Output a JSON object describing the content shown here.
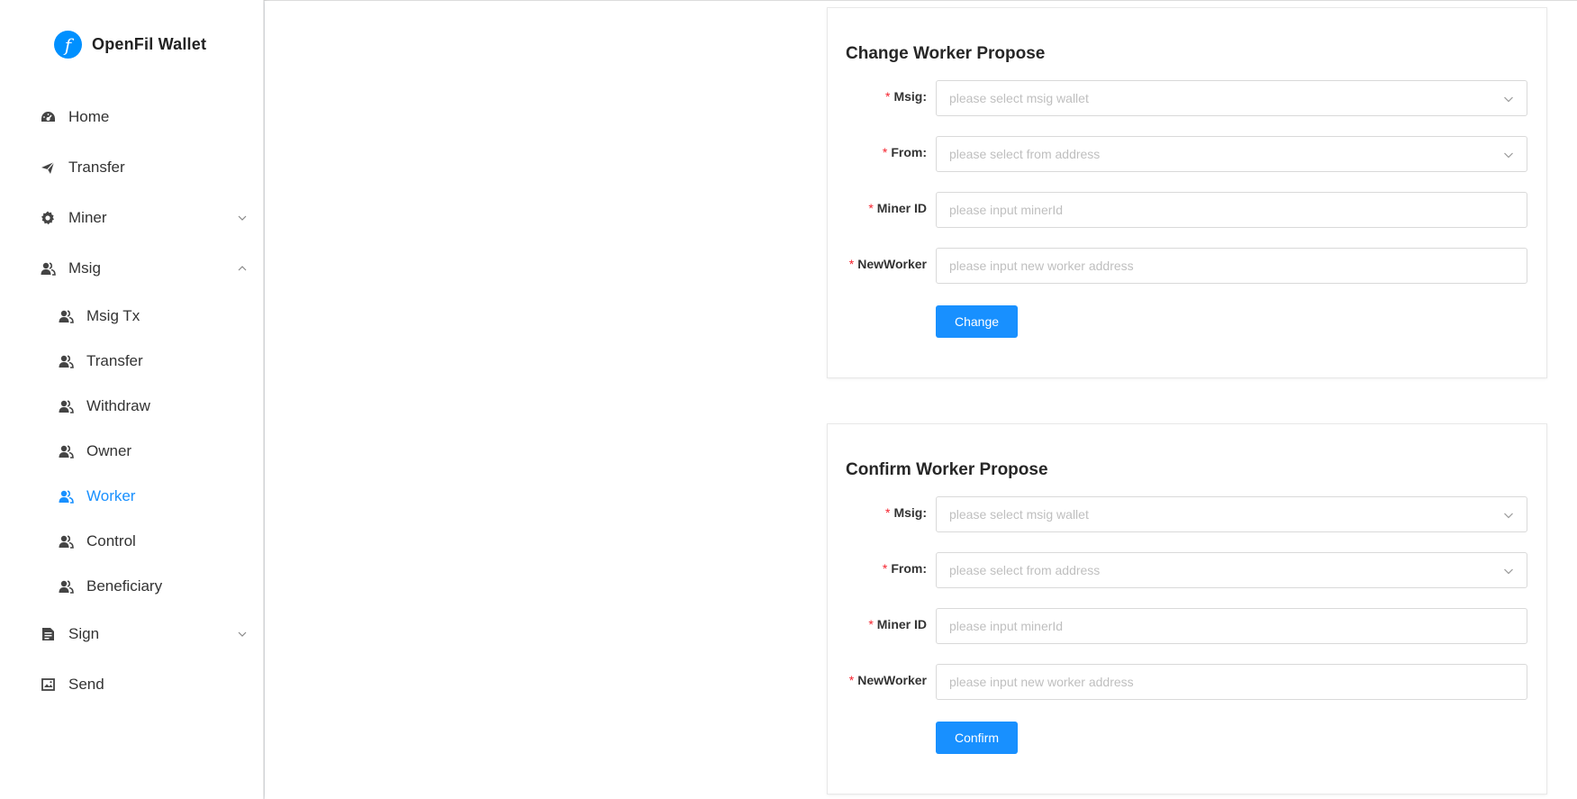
{
  "app": {
    "title": "OpenFil Wallet",
    "logo_glyph": "f",
    "accent_color": "#1890ff"
  },
  "sidebar": {
    "items": [
      {
        "label": "Home",
        "icon": "dashboard-icon"
      },
      {
        "label": "Transfer",
        "icon": "send-icon"
      },
      {
        "label": "Miner",
        "icon": "gear-icon",
        "expandable": true,
        "expanded": false
      },
      {
        "label": "Msig",
        "icon": "users-icon",
        "expandable": true,
        "expanded": true
      },
      {
        "label": "Sign",
        "icon": "file-icon",
        "expandable": true,
        "expanded": false
      },
      {
        "label": "Send",
        "icon": "image-icon"
      }
    ],
    "msig_sub": [
      {
        "label": "Msig Tx",
        "icon": "users-icon"
      },
      {
        "label": "Transfer",
        "icon": "users-icon"
      },
      {
        "label": "Withdraw",
        "icon": "users-icon"
      },
      {
        "label": "Owner",
        "icon": "users-icon"
      },
      {
        "label": "Worker",
        "icon": "users-icon",
        "active": true
      },
      {
        "label": "Control",
        "icon": "users-icon"
      },
      {
        "label": "Beneficiary",
        "icon": "users-icon"
      }
    ]
  },
  "forms": [
    {
      "title": "Change Worker Propose",
      "fields": [
        {
          "label": "Msig:",
          "placeholder": "please select msig wallet",
          "type": "select"
        },
        {
          "label": "From:",
          "placeholder": "please select from address",
          "type": "select"
        },
        {
          "label": "Miner ID",
          "placeholder": "please input minerId",
          "type": "input"
        },
        {
          "label": "NewWorker",
          "placeholder": "please input new worker address",
          "type": "input"
        }
      ],
      "button": "Change"
    },
    {
      "title": "Confirm Worker Propose",
      "fields": [
        {
          "label": "Msig:",
          "placeholder": "please select msig wallet",
          "type": "select"
        },
        {
          "label": "From:",
          "placeholder": "please select from address",
          "type": "select"
        },
        {
          "label": "Miner ID",
          "placeholder": "please input minerId",
          "type": "input"
        },
        {
          "label": "NewWorker",
          "placeholder": "please input new worker address",
          "type": "input"
        }
      ],
      "button": "Confirm"
    }
  ],
  "required_mark": "*"
}
